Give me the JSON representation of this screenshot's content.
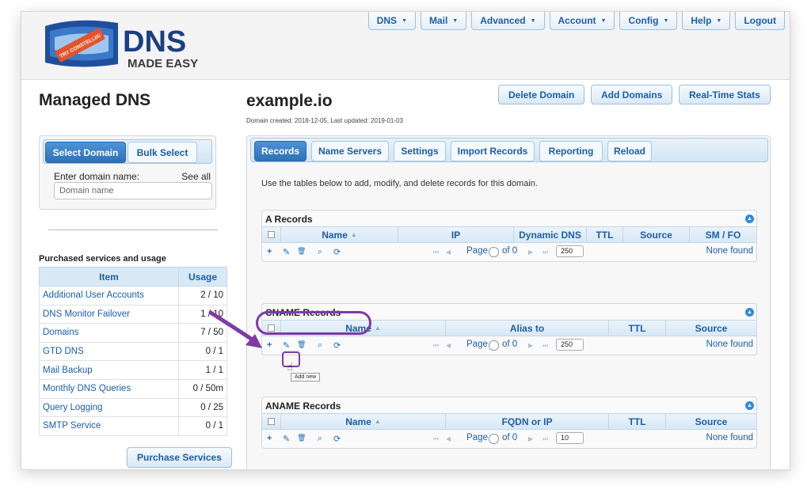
{
  "header": {
    "logo_badge": "TRY CONSTELLIX!",
    "logo_main": "DNS",
    "logo_sub": "MADE EASY",
    "nav": [
      {
        "label": "DNS",
        "has_caret": true
      },
      {
        "label": "Mail",
        "has_caret": true
      },
      {
        "label": "Advanced",
        "has_caret": true
      },
      {
        "label": "Account",
        "has_caret": true
      },
      {
        "label": "Config",
        "has_caret": true
      },
      {
        "label": "Help",
        "has_caret": true
      },
      {
        "label": "Logout",
        "has_caret": false
      }
    ],
    "caret": "▼"
  },
  "left": {
    "page_title": "Managed DNS",
    "tabs": [
      "Select Domain",
      "Bulk Select"
    ],
    "enter_label": "Enter domain name:",
    "see_all": "See all",
    "domain_placeholder": "Domain name",
    "services_heading": "Purchased services and usage",
    "services_columns": [
      "Item",
      "Usage"
    ],
    "services": [
      {
        "item": "Additional User Accounts",
        "usage": "2 / 10"
      },
      {
        "item": "DNS Monitor Failover",
        "usage": "1 / 10"
      },
      {
        "item": "Domains",
        "usage": "7 / 50"
      },
      {
        "item": "GTD DNS",
        "usage": "0 / 1"
      },
      {
        "item": "Mail Backup",
        "usage": "1 / 1"
      },
      {
        "item": "Monthly DNS Queries",
        "usage": "0 / 50m"
      },
      {
        "item": "Query Logging",
        "usage": "0 / 25"
      },
      {
        "item": "SMTP Service",
        "usage": "0 / 1"
      }
    ],
    "purchase_button": "Purchase Services"
  },
  "main": {
    "domain": "example.io",
    "meta": "Domain created: 2018-12-05, Last updated: 2019-01-03",
    "actions": [
      "Delete Domain",
      "Add Domains",
      "Real-Time Stats"
    ],
    "tabs": [
      "Records",
      "Name Servers",
      "Settings",
      "Import Records",
      "Reporting",
      "Reload"
    ],
    "intro": "Use the tables below to add, modify, and delete records for this domain.",
    "pager_page": "Page",
    "pager_of": "of 0",
    "none_found": "None found",
    "add_tooltip": "Add new",
    "tables": [
      {
        "title": "A Records",
        "columns": [
          "Name",
          "IP",
          "Dynamic DNS",
          "TTL",
          "Source",
          "SM / FO"
        ],
        "page_size": "250"
      },
      {
        "title": "CNAME Records",
        "columns": [
          "Name",
          "Alias to",
          "TTL",
          "Source"
        ],
        "page_size": "250"
      },
      {
        "title": "ANAME Records",
        "columns": [
          "Name",
          "FQDN or IP",
          "TTL",
          "Source"
        ],
        "page_size": "10"
      }
    ]
  },
  "icons": {
    "add": "+",
    "edit": "✎",
    "delete": "🗑",
    "search": "⌕",
    "refresh": "⟳",
    "first": "⏮",
    "prev": "◀",
    "next": "▶",
    "last": "⏭",
    "collapse": "▲",
    "sort": "▲"
  },
  "colors": {
    "accent": "#1b5ea6",
    "active_tab": "#2d71b8",
    "highlight": "#7f3aa6"
  }
}
